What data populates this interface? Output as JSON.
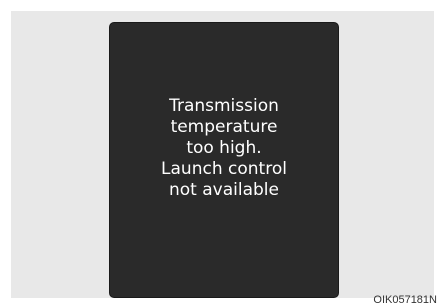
{
  "display": {
    "message_lines": [
      "Transmission",
      "temperature",
      "too high.",
      "Launch control",
      "not available"
    ]
  },
  "figure_code": "OIK057181N",
  "colors": {
    "panel_background": "#2a2a2a",
    "panel_text": "#ffffff",
    "frame_background": "#e8e8e8"
  }
}
